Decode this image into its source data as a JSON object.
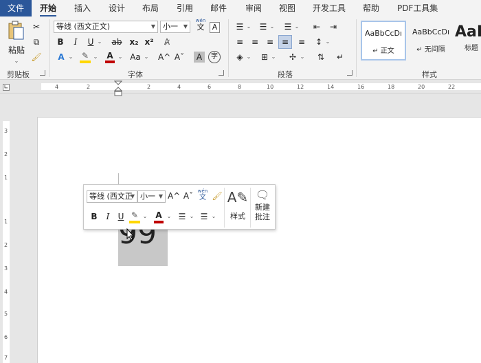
{
  "menu": {
    "tabs": [
      "文件",
      "开始",
      "插入",
      "设计",
      "布局",
      "引用",
      "邮件",
      "审阅",
      "视图",
      "开发工具",
      "帮助",
      "PDF工具集"
    ],
    "active": "开始"
  },
  "ribbon": {
    "clipboard": {
      "paste_label": "粘贴",
      "group_label": "剪贴板"
    },
    "font": {
      "font_name": "等线 (西文正文)",
      "font_size": "小一",
      "group_label": "字体",
      "wen_label": "wén",
      "wen_char": "文",
      "a_box": "A",
      "bold": "B",
      "italic": "I",
      "underline": "U",
      "strike": "ab",
      "subscript": "x₂",
      "superscript": "x²",
      "grow": "A^",
      "shrink": "Aˇ",
      "case": "Aa",
      "charshade": "A",
      "enclose": "字"
    },
    "paragraph": {
      "group_label": "段落"
    },
    "styles": {
      "group_label": "样式",
      "items": [
        {
          "preview": "AaBbCcDı",
          "name": "↵ 正文"
        },
        {
          "preview": "AaBbCcDı",
          "name": "↵ 无间隔"
        },
        {
          "preview": "AaI",
          "name": "标题"
        }
      ]
    }
  },
  "hruler": {
    "labels": [
      "4",
      "2",
      "2",
      "4",
      "6",
      "8",
      "10",
      "12",
      "14",
      "16",
      "18",
      "20",
      "22"
    ]
  },
  "vruler": {
    "labels": [
      "3",
      "2",
      "1",
      "1",
      "2",
      "3",
      "4",
      "5",
      "6",
      "7"
    ]
  },
  "document": {
    "selected_text": "99"
  },
  "mini_toolbar": {
    "font_name": "等线 (西文正",
    "font_size": "小一",
    "bold": "B",
    "italic": "I",
    "underline": "U",
    "grow": "A^",
    "shrink": "Aˇ",
    "wen": "wén",
    "wen_char": "文",
    "styles_label": "样式",
    "new_comment_line1": "新建",
    "new_comment_line2": "批注"
  },
  "colors": {
    "file_tab": "#2b579a",
    "highlight": "#ffd700",
    "font_color": "#c00000",
    "selection": "#c8c8c8"
  }
}
